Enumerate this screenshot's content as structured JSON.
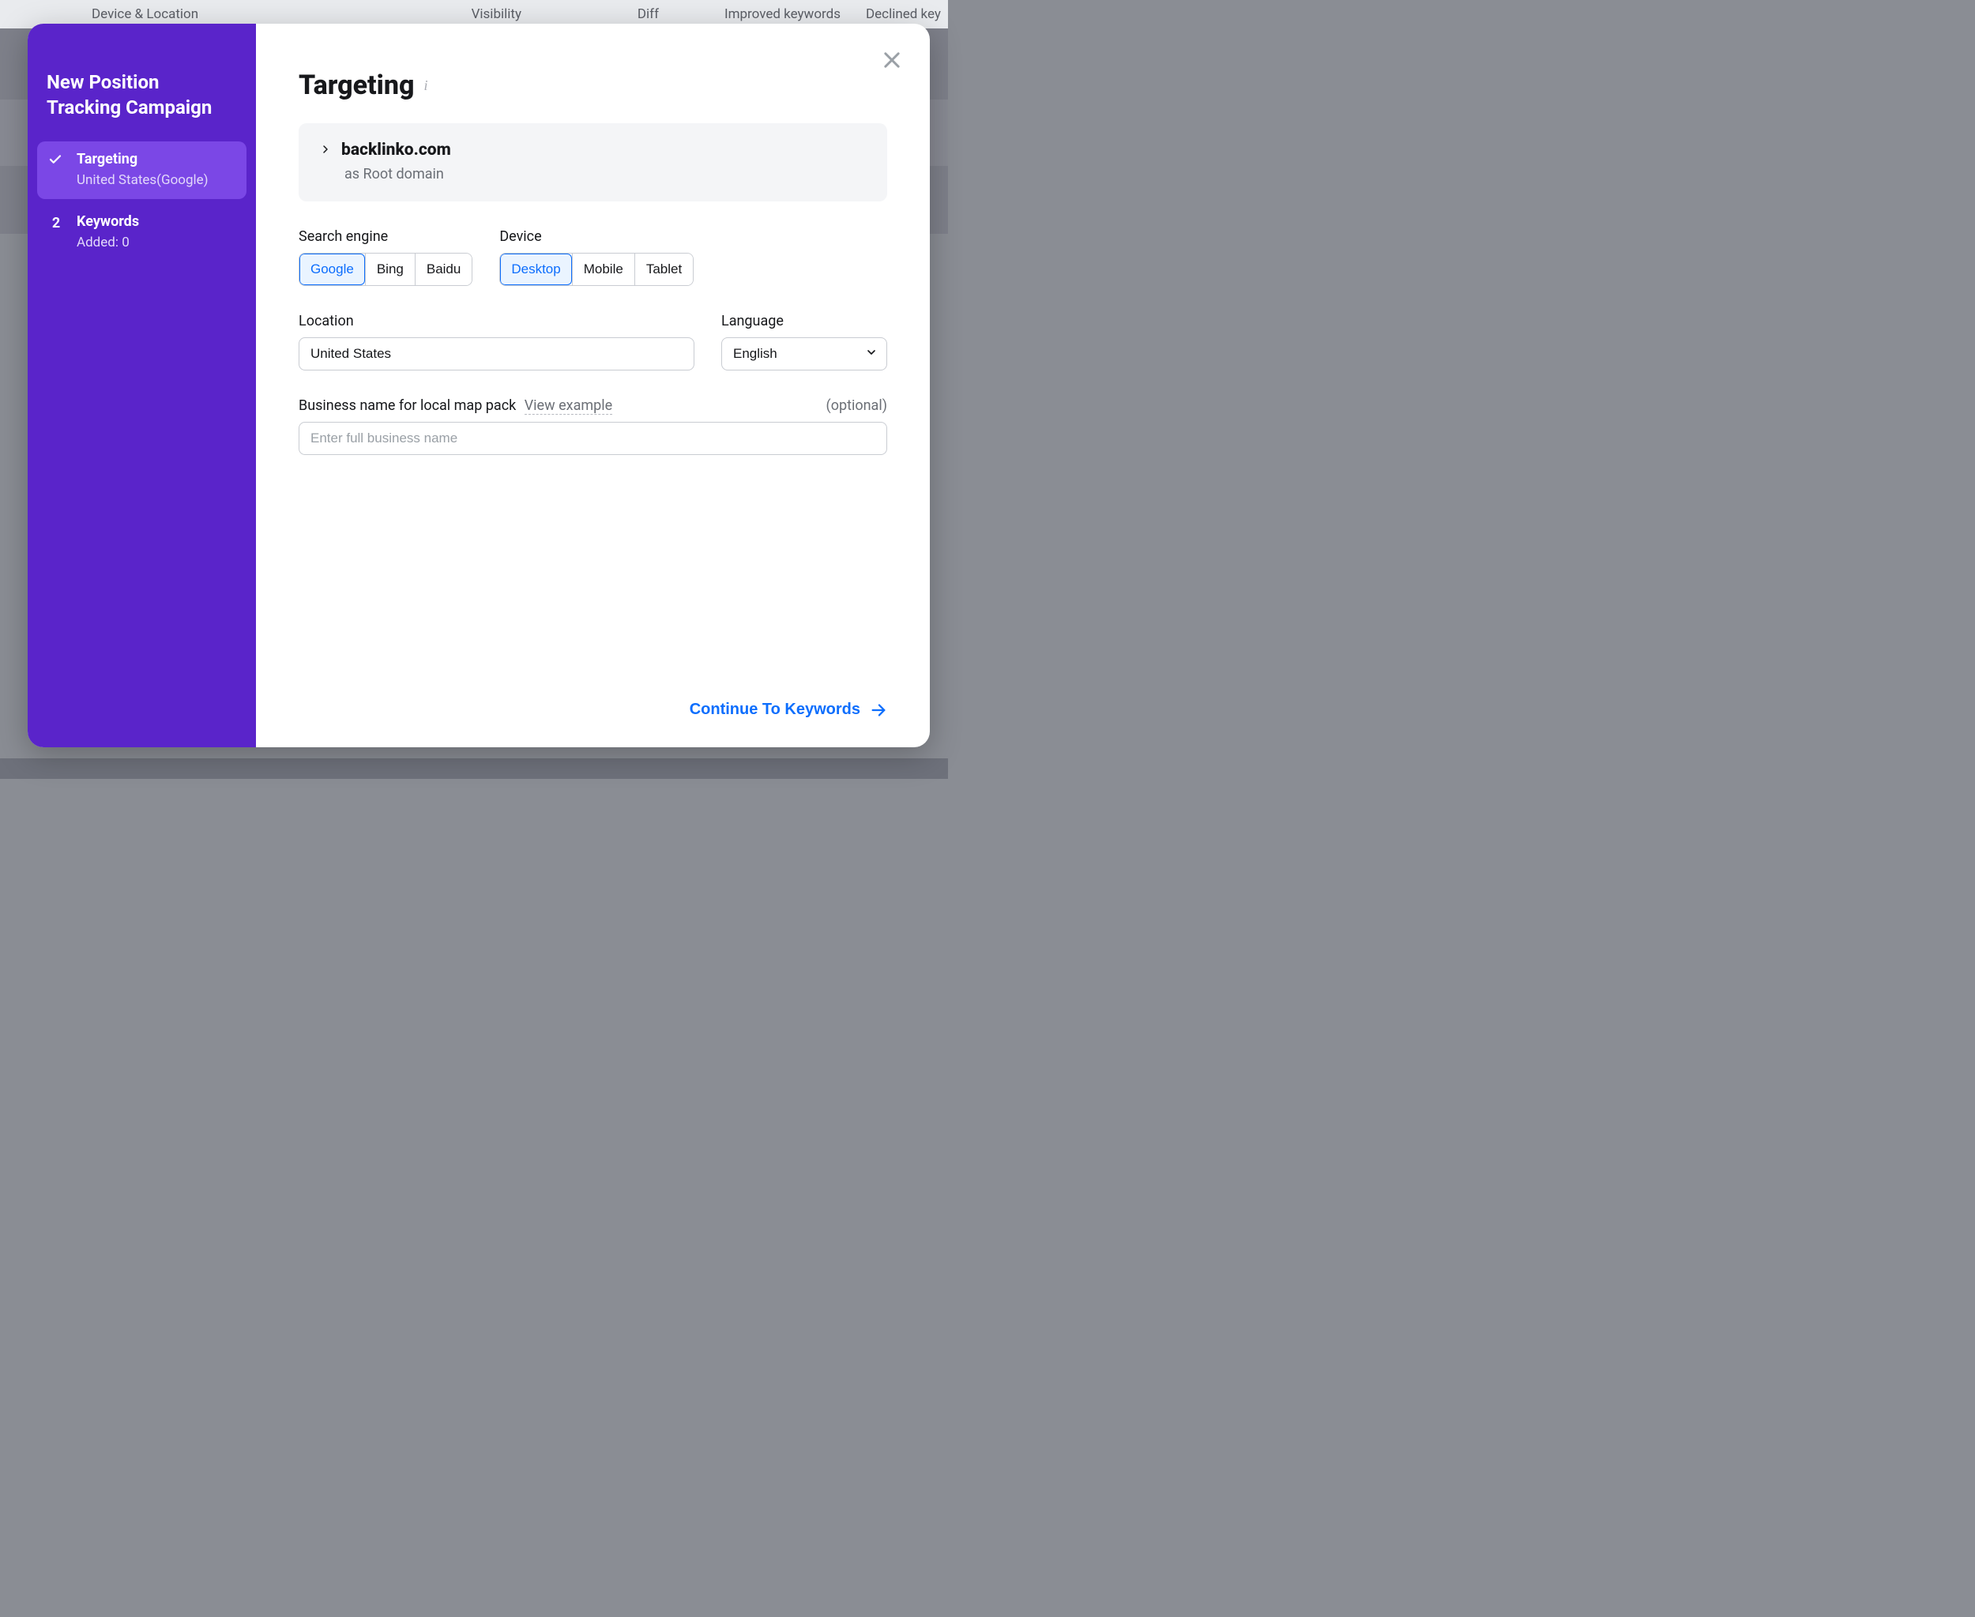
{
  "background": {
    "columns": [
      "Device & Location",
      "Visibility",
      "Diff",
      "Improved keywords",
      "Declined key"
    ]
  },
  "sidebar": {
    "title": "New Position Tracking Campaign",
    "steps": [
      {
        "num": "✓",
        "label": "Targeting",
        "sub": "United States(Google)",
        "active": true,
        "is_check": true
      },
      {
        "num": "2",
        "label": "Keywords",
        "sub": "Added: 0",
        "active": false,
        "is_check": false
      }
    ]
  },
  "main": {
    "title": "Targeting",
    "info_glyph": "i",
    "domain": {
      "name": "backlinko.com",
      "sub": "as Root domain"
    },
    "search_engine": {
      "label": "Search engine",
      "options": [
        "Google",
        "Bing",
        "Baidu"
      ],
      "selected": "Google"
    },
    "device": {
      "label": "Device",
      "options": [
        "Desktop",
        "Mobile",
        "Tablet"
      ],
      "selected": "Desktop"
    },
    "location": {
      "label": "Location",
      "value": "United States"
    },
    "language": {
      "label": "Language",
      "value": "English"
    },
    "business": {
      "label": "Business name for local map pack",
      "view_example": "View example",
      "optional": "(optional)",
      "placeholder": "Enter full business name"
    },
    "continue_label": "Continue To Keywords"
  }
}
